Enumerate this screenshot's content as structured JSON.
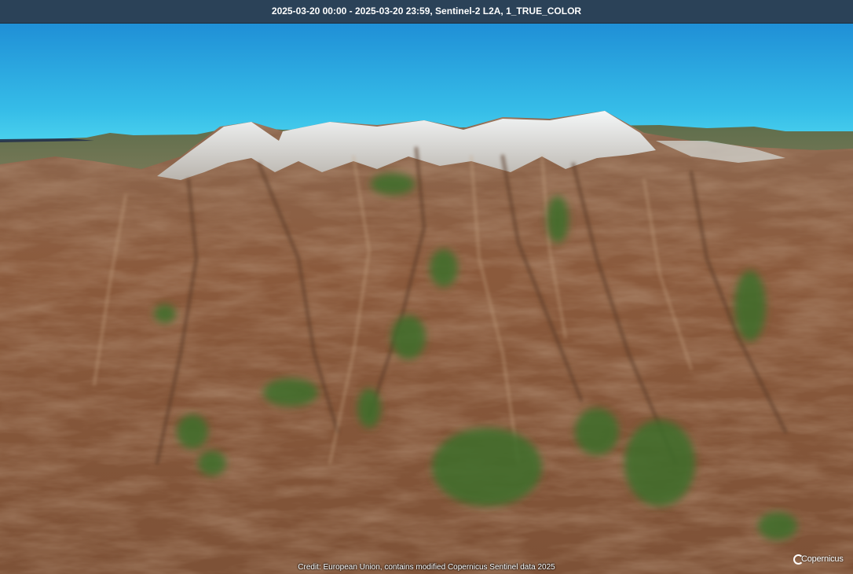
{
  "header": {
    "title": "2025-03-20 00:00 - 2025-03-20 23:59, Sentinel-2 L2A, 1_TRUE_COLOR"
  },
  "footer": {
    "credit": "Credit: European Union, contains modified Copernicus Sentinel data 2025"
  },
  "logo": {
    "name": "Copernicus",
    "icon": "copernicus-logo-icon"
  },
  "colors": {
    "titlebar": "#2b4258",
    "sky_top": "#1f8fd6",
    "sky_horizon": "#44d0ee",
    "snow": "#e9eef0",
    "terrain": "#8a5a3c",
    "vegetation": "#3c6e2a"
  }
}
